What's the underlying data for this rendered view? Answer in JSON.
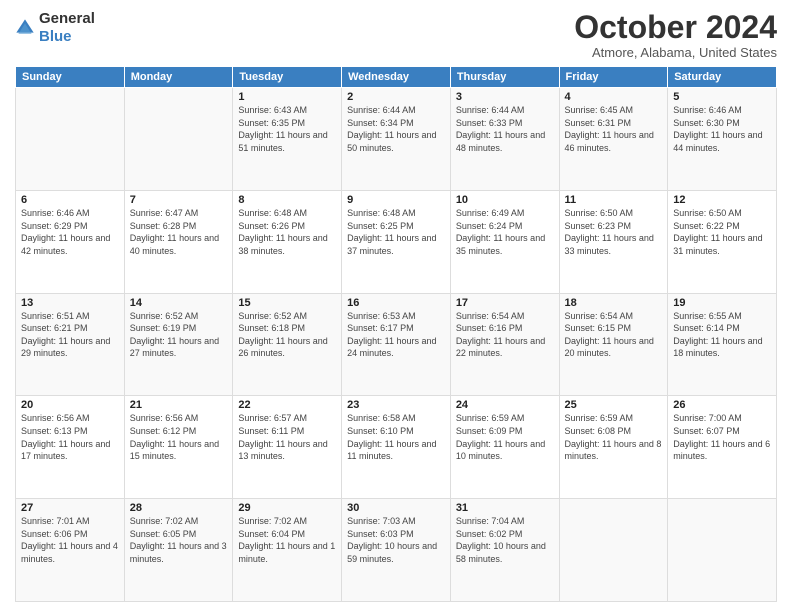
{
  "logo": {
    "general": "General",
    "blue": "Blue"
  },
  "header": {
    "month": "October 2024",
    "location": "Atmore, Alabama, United States"
  },
  "days_of_week": [
    "Sunday",
    "Monday",
    "Tuesday",
    "Wednesday",
    "Thursday",
    "Friday",
    "Saturday"
  ],
  "weeks": [
    [
      {
        "day": "",
        "info": ""
      },
      {
        "day": "",
        "info": ""
      },
      {
        "day": "1",
        "info": "Sunrise: 6:43 AM\nSunset: 6:35 PM\nDaylight: 11 hours and 51 minutes."
      },
      {
        "day": "2",
        "info": "Sunrise: 6:44 AM\nSunset: 6:34 PM\nDaylight: 11 hours and 50 minutes."
      },
      {
        "day": "3",
        "info": "Sunrise: 6:44 AM\nSunset: 6:33 PM\nDaylight: 11 hours and 48 minutes."
      },
      {
        "day": "4",
        "info": "Sunrise: 6:45 AM\nSunset: 6:31 PM\nDaylight: 11 hours and 46 minutes."
      },
      {
        "day": "5",
        "info": "Sunrise: 6:46 AM\nSunset: 6:30 PM\nDaylight: 11 hours and 44 minutes."
      }
    ],
    [
      {
        "day": "6",
        "info": "Sunrise: 6:46 AM\nSunset: 6:29 PM\nDaylight: 11 hours and 42 minutes."
      },
      {
        "day": "7",
        "info": "Sunrise: 6:47 AM\nSunset: 6:28 PM\nDaylight: 11 hours and 40 minutes."
      },
      {
        "day": "8",
        "info": "Sunrise: 6:48 AM\nSunset: 6:26 PM\nDaylight: 11 hours and 38 minutes."
      },
      {
        "day": "9",
        "info": "Sunrise: 6:48 AM\nSunset: 6:25 PM\nDaylight: 11 hours and 37 minutes."
      },
      {
        "day": "10",
        "info": "Sunrise: 6:49 AM\nSunset: 6:24 PM\nDaylight: 11 hours and 35 minutes."
      },
      {
        "day": "11",
        "info": "Sunrise: 6:50 AM\nSunset: 6:23 PM\nDaylight: 11 hours and 33 minutes."
      },
      {
        "day": "12",
        "info": "Sunrise: 6:50 AM\nSunset: 6:22 PM\nDaylight: 11 hours and 31 minutes."
      }
    ],
    [
      {
        "day": "13",
        "info": "Sunrise: 6:51 AM\nSunset: 6:21 PM\nDaylight: 11 hours and 29 minutes."
      },
      {
        "day": "14",
        "info": "Sunrise: 6:52 AM\nSunset: 6:19 PM\nDaylight: 11 hours and 27 minutes."
      },
      {
        "day": "15",
        "info": "Sunrise: 6:52 AM\nSunset: 6:18 PM\nDaylight: 11 hours and 26 minutes."
      },
      {
        "day": "16",
        "info": "Sunrise: 6:53 AM\nSunset: 6:17 PM\nDaylight: 11 hours and 24 minutes."
      },
      {
        "day": "17",
        "info": "Sunrise: 6:54 AM\nSunset: 6:16 PM\nDaylight: 11 hours and 22 minutes."
      },
      {
        "day": "18",
        "info": "Sunrise: 6:54 AM\nSunset: 6:15 PM\nDaylight: 11 hours and 20 minutes."
      },
      {
        "day": "19",
        "info": "Sunrise: 6:55 AM\nSunset: 6:14 PM\nDaylight: 11 hours and 18 minutes."
      }
    ],
    [
      {
        "day": "20",
        "info": "Sunrise: 6:56 AM\nSunset: 6:13 PM\nDaylight: 11 hours and 17 minutes."
      },
      {
        "day": "21",
        "info": "Sunrise: 6:56 AM\nSunset: 6:12 PM\nDaylight: 11 hours and 15 minutes."
      },
      {
        "day": "22",
        "info": "Sunrise: 6:57 AM\nSunset: 6:11 PM\nDaylight: 11 hours and 13 minutes."
      },
      {
        "day": "23",
        "info": "Sunrise: 6:58 AM\nSunset: 6:10 PM\nDaylight: 11 hours and 11 minutes."
      },
      {
        "day": "24",
        "info": "Sunrise: 6:59 AM\nSunset: 6:09 PM\nDaylight: 11 hours and 10 minutes."
      },
      {
        "day": "25",
        "info": "Sunrise: 6:59 AM\nSunset: 6:08 PM\nDaylight: 11 hours and 8 minutes."
      },
      {
        "day": "26",
        "info": "Sunrise: 7:00 AM\nSunset: 6:07 PM\nDaylight: 11 hours and 6 minutes."
      }
    ],
    [
      {
        "day": "27",
        "info": "Sunrise: 7:01 AM\nSunset: 6:06 PM\nDaylight: 11 hours and 4 minutes."
      },
      {
        "day": "28",
        "info": "Sunrise: 7:02 AM\nSunset: 6:05 PM\nDaylight: 11 hours and 3 minutes."
      },
      {
        "day": "29",
        "info": "Sunrise: 7:02 AM\nSunset: 6:04 PM\nDaylight: 11 hours and 1 minute."
      },
      {
        "day": "30",
        "info": "Sunrise: 7:03 AM\nSunset: 6:03 PM\nDaylight: 10 hours and 59 minutes."
      },
      {
        "day": "31",
        "info": "Sunrise: 7:04 AM\nSunset: 6:02 PM\nDaylight: 10 hours and 58 minutes."
      },
      {
        "day": "",
        "info": ""
      },
      {
        "day": "",
        "info": ""
      }
    ]
  ]
}
